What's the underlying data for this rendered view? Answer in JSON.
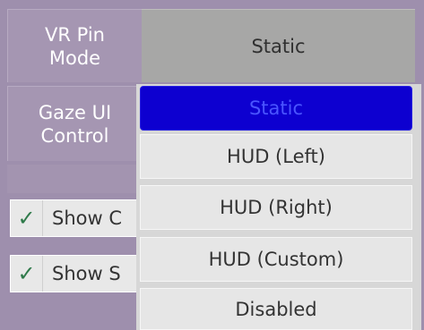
{
  "vr_pin_mode": {
    "label": "VR Pin Mode",
    "label_line1": "VR Pin",
    "label_line2": "Mode",
    "selected_value": "Static"
  },
  "gaze_ui_control": {
    "label_line1": "Gaze UI",
    "label_line2": "Control"
  },
  "toggles": [
    {
      "checked": true,
      "text": "Show C"
    },
    {
      "checked": true,
      "text": "Show S"
    }
  ],
  "dropdown": {
    "options": [
      "Static",
      "HUD (Left)",
      "HUD (Right)",
      "HUD (Custom)",
      "Disabled"
    ],
    "selected_index": 0
  },
  "colors": {
    "background": "#9e8fad",
    "selected_option": "#0d00d0",
    "check": "#2f7a4a"
  },
  "icons": {
    "check": "checkmark-icon"
  }
}
